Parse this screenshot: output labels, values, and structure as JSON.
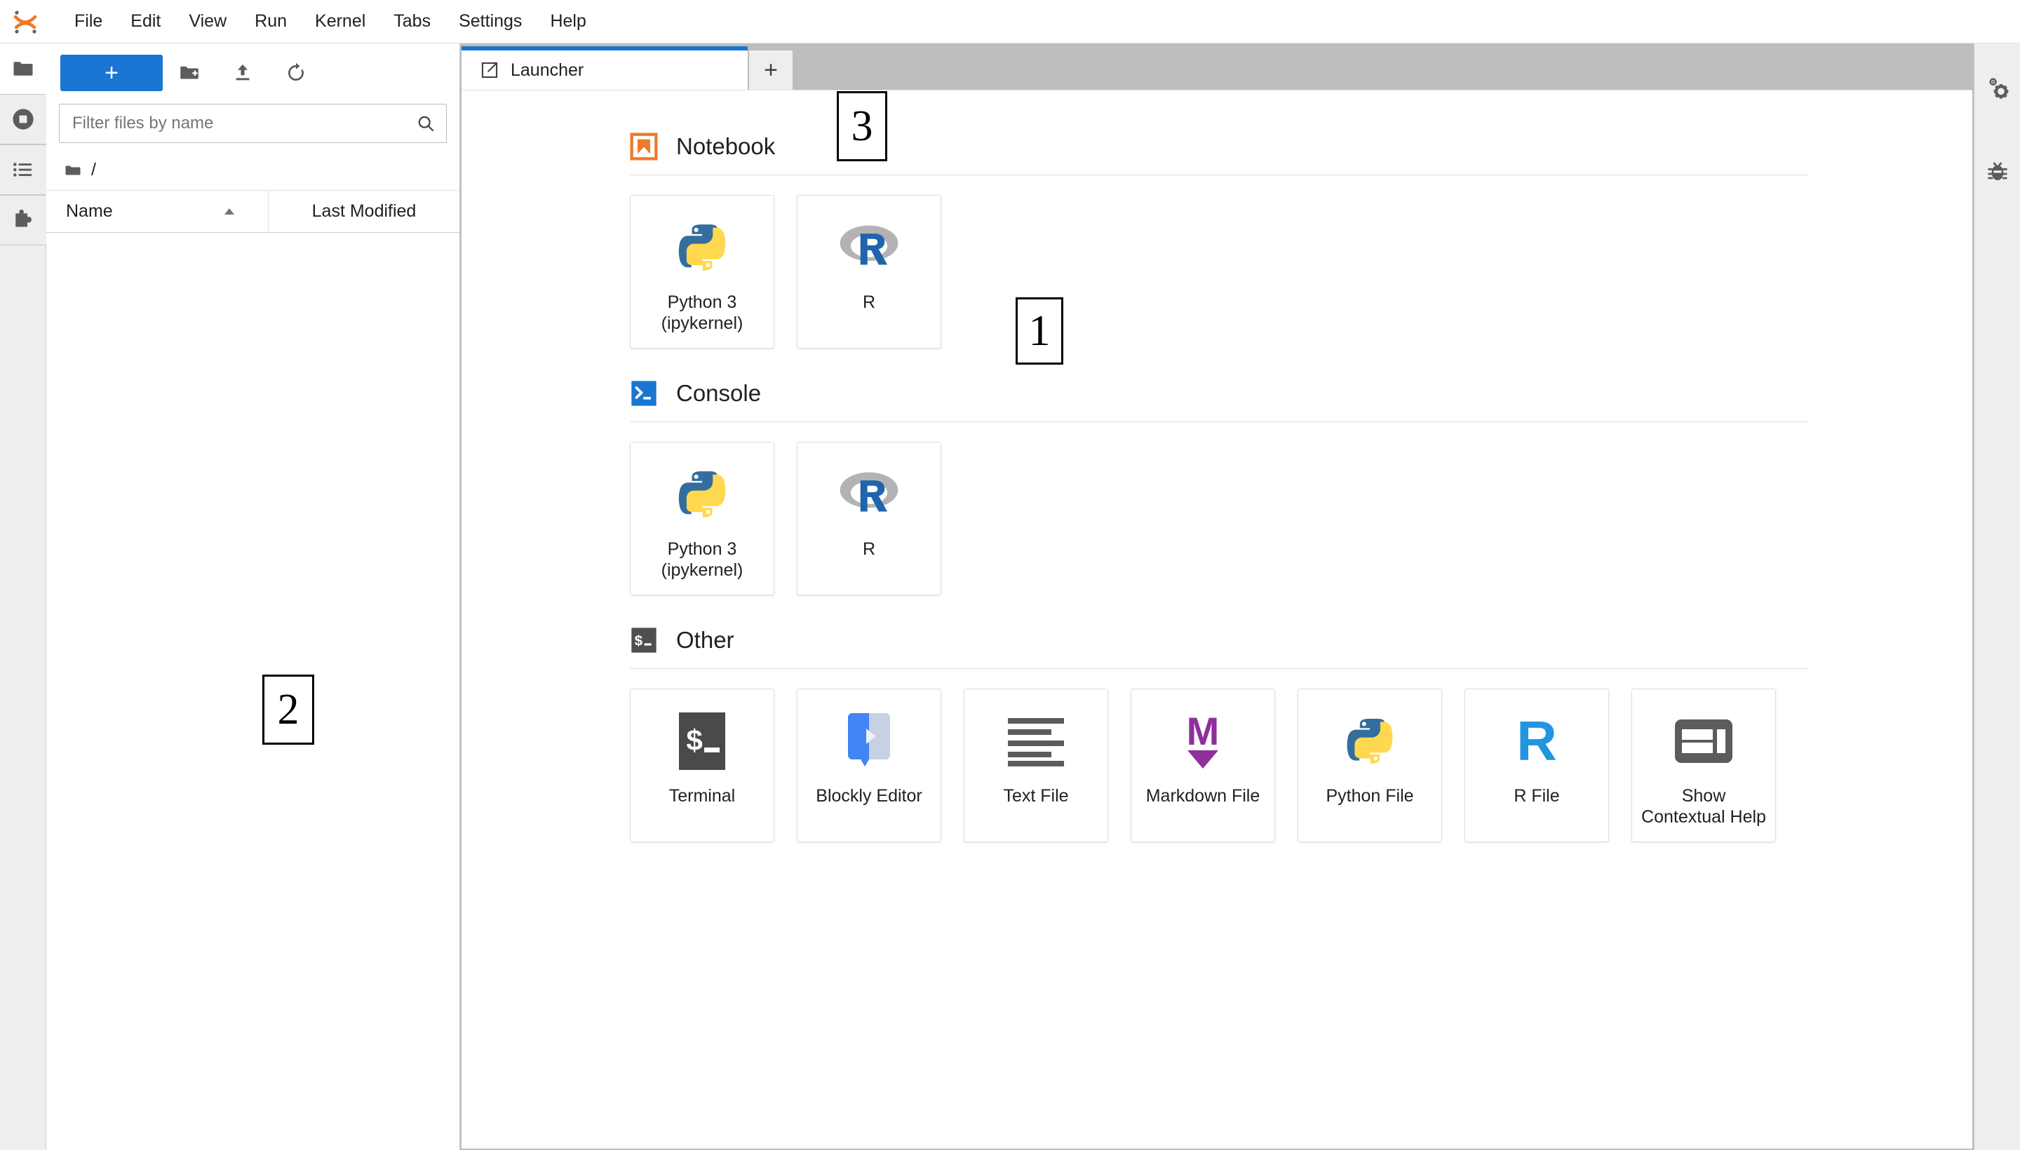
{
  "app": {
    "logo_name": "jupyter-logo"
  },
  "menubar": {
    "items": [
      {
        "label": "File"
      },
      {
        "label": "Edit"
      },
      {
        "label": "View"
      },
      {
        "label": "Run"
      },
      {
        "label": "Kernel"
      },
      {
        "label": "Tabs"
      },
      {
        "label": "Settings"
      },
      {
        "label": "Help"
      }
    ]
  },
  "left_rail": {
    "items": [
      {
        "name": "file-browser-icon",
        "label": "File Browser",
        "active": true
      },
      {
        "name": "running-terminals-icon",
        "label": "Running Terminals and Kernels",
        "active": false
      },
      {
        "name": "table-of-contents-icon",
        "label": "Table of Contents",
        "active": false
      },
      {
        "name": "extension-manager-icon",
        "label": "Extension Manager",
        "active": false
      }
    ]
  },
  "filebrowser": {
    "new_launcher_label": "+",
    "toolbar": [
      {
        "name": "new-folder-icon",
        "label": "New Folder"
      },
      {
        "name": "upload-icon",
        "label": "Upload Files"
      },
      {
        "name": "refresh-icon",
        "label": "Refresh File List"
      }
    ],
    "filter": {
      "placeholder": "Filter files by name",
      "value": ""
    },
    "breadcrumb": "/",
    "columns": {
      "name": "Name",
      "last_modified": "Last Modified"
    },
    "sort": {
      "column": "Name",
      "direction": "ascending"
    },
    "rows": []
  },
  "dock": {
    "tabs": [
      {
        "label": "Launcher",
        "icon": "launcher-icon",
        "active": true
      }
    ],
    "new_tab_label": "+"
  },
  "launcher": {
    "sections": [
      {
        "id": "notebook",
        "title": "Notebook",
        "icon": "notebook-bookmark-icon",
        "icon_color": "#ee7a2a",
        "cards": [
          {
            "label": "Python 3\n(ipykernel)",
            "label_line1": "Python 3",
            "label_line2": "(ipykernel)",
            "icon": "python-logo-icon"
          },
          {
            "label": "R",
            "label_line1": "R",
            "label_line2": "",
            "icon": "r-logo-icon"
          }
        ]
      },
      {
        "id": "console",
        "title": "Console",
        "icon": "console-prompt-icon",
        "icon_color": "#1976d2",
        "cards": [
          {
            "label": "Python 3\n(ipykernel)",
            "label_line1": "Python 3",
            "label_line2": "(ipykernel)",
            "icon": "python-logo-icon"
          },
          {
            "label": "R",
            "label_line1": "R",
            "label_line2": "",
            "icon": "r-logo-icon"
          }
        ]
      },
      {
        "id": "other",
        "title": "Other",
        "icon": "terminal-dollar-icon",
        "icon_color": "#4f4f4f",
        "cards": [
          {
            "label": "Terminal",
            "label_line1": "Terminal",
            "label_line2": "",
            "icon": "terminal-dollar-icon"
          },
          {
            "label": "Blockly Editor",
            "label_line1": "Blockly Editor",
            "label_line2": "",
            "icon": "blockly-icon"
          },
          {
            "label": "Text File",
            "label_line1": "Text File",
            "label_line2": "",
            "icon": "text-file-icon"
          },
          {
            "label": "Markdown File",
            "label_line1": "Markdown File",
            "label_line2": "",
            "icon": "markdown-icon"
          },
          {
            "label": "Python File",
            "label_line1": "Python File",
            "label_line2": "",
            "icon": "python-logo-icon"
          },
          {
            "label": "R File",
            "label_line1": "R File",
            "label_line2": "",
            "icon": "r-letter-icon"
          },
          {
            "label": "Show Contextual Help",
            "label_line1": "Show",
            "label_line2": "Contextual Help",
            "icon": "contextual-help-icon"
          }
        ]
      }
    ]
  },
  "right_rail": {
    "items": [
      {
        "name": "property-inspector-icon",
        "label": "Property Inspector"
      },
      {
        "name": "debugger-icon",
        "label": "Debugger"
      }
    ]
  },
  "annotations": [
    {
      "id": "1",
      "label": "1"
    },
    {
      "id": "2",
      "label": "2"
    },
    {
      "id": "3",
      "label": "3"
    }
  ],
  "colors": {
    "accent_blue": "#1976d2",
    "notebook_orange": "#ee7a2a",
    "markdown_purple": "#8e2f9c",
    "r_blue": "#2195e0",
    "terminal_dark": "#4f4f4f"
  }
}
